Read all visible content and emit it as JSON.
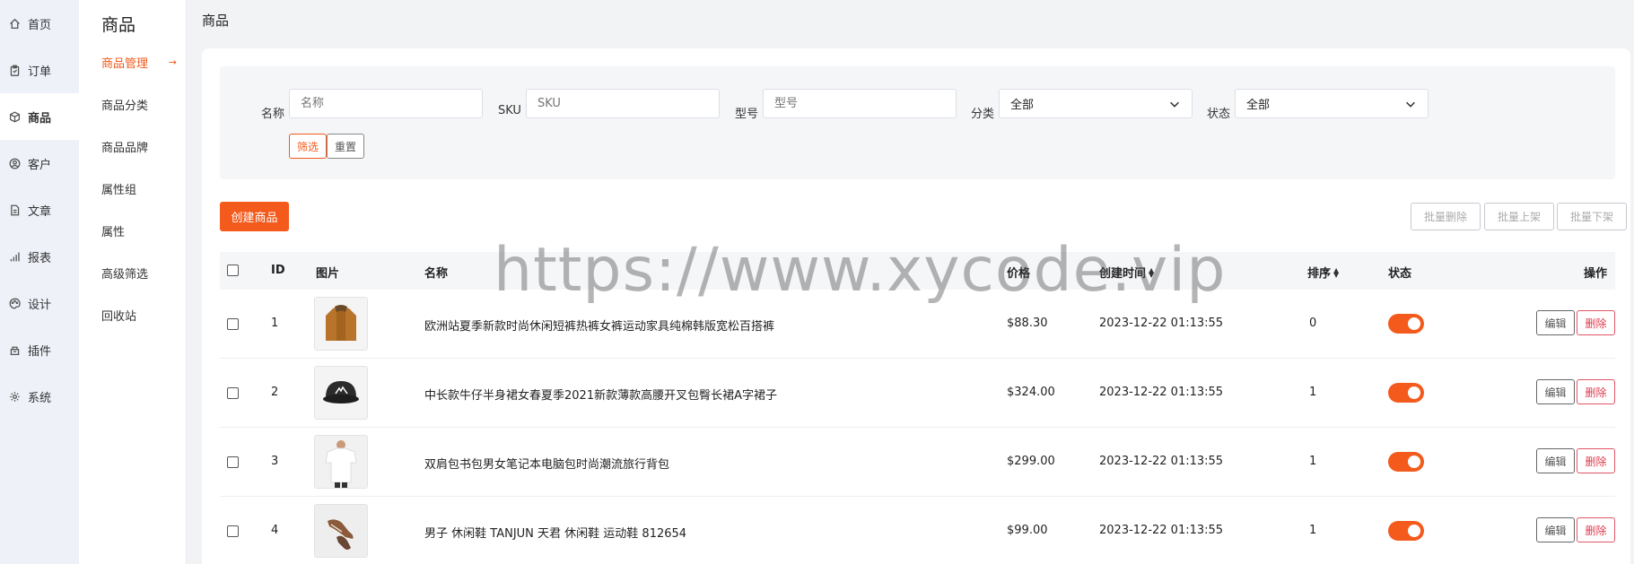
{
  "nav": {
    "items": [
      {
        "label": "首页",
        "icon": "home-icon"
      },
      {
        "label": "订单",
        "icon": "clipboard-icon"
      },
      {
        "label": "商品",
        "icon": "cube-icon"
      },
      {
        "label": "客户",
        "icon": "user-circle-icon"
      },
      {
        "label": "文章",
        "icon": "document-icon"
      },
      {
        "label": "报表",
        "icon": "bar-chart-icon"
      },
      {
        "label": "设计",
        "icon": "palette-icon"
      },
      {
        "label": "插件",
        "icon": "plugin-icon"
      },
      {
        "label": "系统",
        "icon": "gear-icon"
      }
    ],
    "active_index": 2
  },
  "submenu": {
    "title": "商品",
    "items": [
      "商品管理",
      "商品分类",
      "商品品牌",
      "属性组",
      "属性",
      "高级筛选",
      "回收站"
    ],
    "active_arrow": "→"
  },
  "page": {
    "title": "商品"
  },
  "filter": {
    "name_label": "名称",
    "name_placeholder": "名称",
    "sku_label": "SKU",
    "sku_placeholder": "SKU",
    "model_label": "型号",
    "model_placeholder": "型号",
    "category_label": "分类",
    "category_value": "全部",
    "status_label": "状态",
    "status_value": "全部",
    "filter_button": "筛选",
    "reset_button": "重置"
  },
  "toolbar": {
    "create_button": "创建商品",
    "batch_delete": "批量删除",
    "batch_on": "批量上架",
    "batch_off": "批量下架"
  },
  "table": {
    "headers": {
      "id": "ID",
      "image": "图片",
      "name": "名称",
      "price": "价格",
      "created": "创建时间",
      "sort": "排序",
      "status": "状态",
      "actions": "操作"
    },
    "rows": [
      {
        "id": "1",
        "name": "欧洲站夏季新款时尚休闲短裤热裤女裤运动家具纯棉韩版宽松百搭裤",
        "price": "$88.30",
        "created": "2023-12-22 01:13:55",
        "sort": "0",
        "status_on": true,
        "image": "jacket"
      },
      {
        "id": "2",
        "name": "中长款牛仔半身裙女春夏季2021新款薄款高腰开叉包臀长裙A字裙子",
        "price": "$324.00",
        "created": "2023-12-22 01:13:55",
        "sort": "1",
        "status_on": true,
        "image": "cap"
      },
      {
        "id": "3",
        "name": "双肩包书包男女笔记本电脑包时尚潮流旅行背包",
        "price": "$299.00",
        "created": "2023-12-22 01:13:55",
        "sort": "1",
        "status_on": true,
        "image": "tshirt"
      },
      {
        "id": "4",
        "name": "男子 休闲鞋 TANJUN 天君 休闲鞋 运动鞋 812654",
        "price": "$99.00",
        "created": "2023-12-22 01:13:55",
        "sort": "1",
        "status_on": true,
        "image": "shoe"
      }
    ],
    "edit_label": "编辑",
    "delete_label": "删除"
  },
  "watermark": "https://www.xycode.vip"
}
